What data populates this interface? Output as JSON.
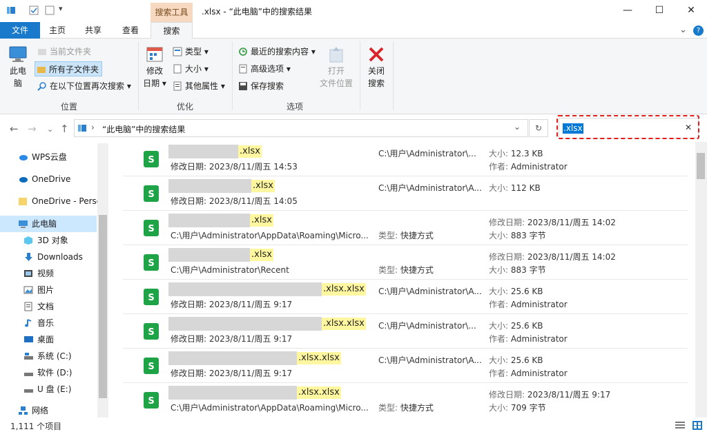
{
  "window": {
    "context_tab": "搜索工具",
    "title": ".xlsx - “此电脑”中的搜索结果",
    "minimize": "—",
    "maximize": "☐",
    "close": "✕",
    "help": "?",
    "expand": "⌄"
  },
  "tabs": {
    "file": "文件",
    "home": "主页",
    "share": "共享",
    "view": "查看",
    "search": "搜索"
  },
  "ribbon": {
    "location": {
      "label": "位置",
      "this_pc_line1": "此电",
      "this_pc_line2": "脑",
      "current_folder": "当前文件夹",
      "all_subfolders": "所有子文件夹",
      "search_again": "在以下位置再次搜索 ▾"
    },
    "refine": {
      "label": "优化",
      "modified_line1": "修改",
      "modified_line2": "日期 ▾",
      "kind": "类型 ▾",
      "size": "大小 ▾",
      "other_props": "其他属性 ▾"
    },
    "options": {
      "label": "选项",
      "recent_searches": "最近的搜索内容 ▾",
      "advanced": "高级选项 ▾",
      "save_search": "保存搜索",
      "open_location_line1": "打开",
      "open_location_line2": "文件位置",
      "close_search_line1": "关闭",
      "close_search_line2": "搜索"
    }
  },
  "address": {
    "separator": "›",
    "path": "“此电脑”中的搜索结果",
    "dropdown": "⌄",
    "refresh": "↻",
    "back": "←",
    "forward": "→",
    "recent": "⌄",
    "up": "↑"
  },
  "search": {
    "value": ".xlsx",
    "clear": "✕"
  },
  "sidebar": {
    "items": [
      {
        "label": "WPS云盘"
      },
      {
        "label": "OneDrive"
      },
      {
        "label": "OneDrive - Perso"
      },
      {
        "label": "此电脑"
      },
      {
        "label": "3D 对象"
      },
      {
        "label": "Downloads"
      },
      {
        "label": "视频"
      },
      {
        "label": "图片"
      },
      {
        "label": "文档"
      },
      {
        "label": "音乐"
      },
      {
        "label": "桌面"
      },
      {
        "label": "系统 (C:)"
      },
      {
        "label": "软件 (D:)"
      },
      {
        "label": "U 盘 (E:)"
      },
      {
        "label": "网络"
      }
    ]
  },
  "results": [
    {
      "name": ".xlsx",
      "sub": "修改日期: 2023/8/11/周五 14:53",
      "mid": "C:\\用户\\Administrator\\...",
      "r1k": "大小:",
      "r1v": "12.3 KB",
      "r2k": "作者:",
      "r2v": "Administrator"
    },
    {
      "name": ".xlsx",
      "sub": "修改日期: 2023/8/11/周五 14:05",
      "mid": "C:\\用户\\Administrator\\A...",
      "r1k": "大小:",
      "r1v": "112 KB",
      "r2k": "",
      "r2v": ""
    },
    {
      "name": ".xlsx",
      "sub": "C:\\用户\\Administrator\\AppData\\Roaming\\Micro...",
      "typek": "类型:",
      "typev": "快捷方式",
      "r1k": "修改日期:",
      "r1v": "2023/8/11/周五 14:02",
      "r2k": "大小:",
      "r2v": "883 字节"
    },
    {
      "name": ".xlsx",
      "sub": "C:\\用户\\Administrator\\Recent",
      "typek": "类型:",
      "typev": "快捷方式",
      "r1k": "修改日期:",
      "r1v": "2023/8/11/周五 14:02",
      "r2k": "大小:",
      "r2v": "883 字节"
    },
    {
      "name": ".xlsx.xlsx",
      "sub": "修改日期: 2023/8/11/周五 9:17",
      "mid": "C:\\用户\\Administrator\\A...",
      "r1k": "大小:",
      "r1v": "25.6 KB",
      "r2k": "作者:",
      "r2v": "Administrator"
    },
    {
      "name": ".xlsx.xlsx",
      "sub": "修改日期: 2023/8/11/周五 9:17",
      "mid": "C:\\用户\\Administrator\\...",
      "r1k": "大小:",
      "r1v": "25.6 KB",
      "r2k": "作者:",
      "r2v": "Administrator"
    },
    {
      "name": ".xlsx.xlsx",
      "sub": "修改日期: 2023/8/11/周五 9:17",
      "mid": "C:\\用户\\Administrator\\A...",
      "r1k": "大小:",
      "r1v": "25.6 KB",
      "r2k": "作者:",
      "r2v": "Administrator"
    },
    {
      "name": ".xlsx.xlsx",
      "sub": "C:\\用户\\Administrator\\AppData\\Roaming\\Micro...",
      "typek": "类型:",
      "typev": "快捷方式",
      "r1k": "修改日期:",
      "r1v": "2023/8/11/周五 9:17",
      "r2k": "大小:",
      "r2v": "709 字节"
    }
  ],
  "status": {
    "count": "1,111 个项目"
  },
  "colors": {
    "accent": "#1979ca",
    "context": "#f6d9c0",
    "highlight": "#fff7a0",
    "selection": "#cce8ff",
    "annotation": "#e21a1a"
  }
}
